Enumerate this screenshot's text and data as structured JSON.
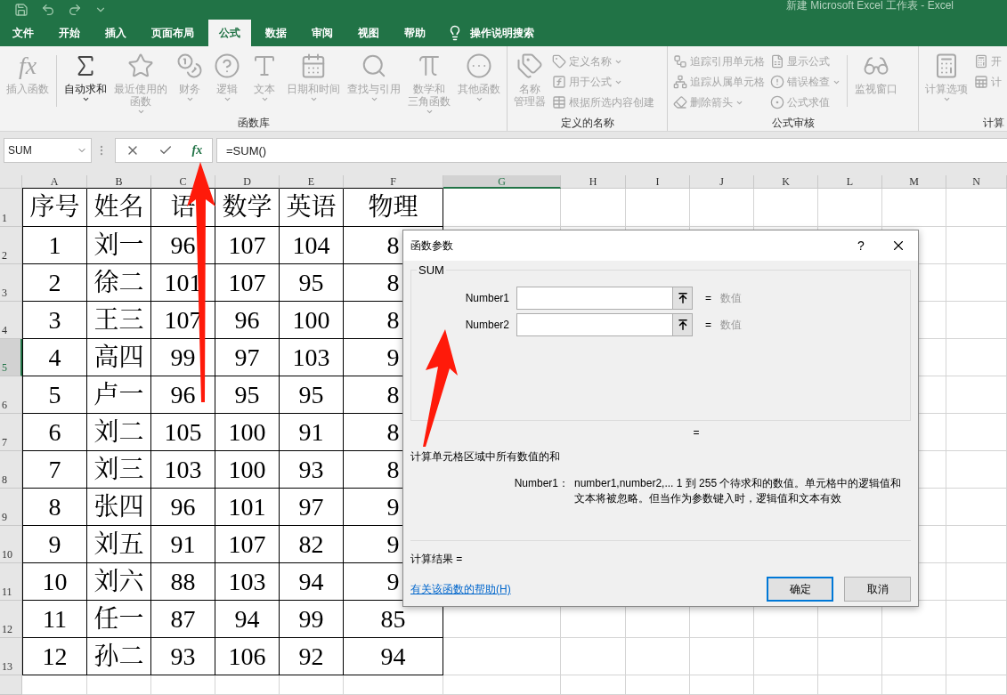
{
  "title_bar": {
    "title": "新建 Microsoft Excel 工作表  -  Excel"
  },
  "ribbon_tabs": [
    {
      "label": "文件",
      "selected": false
    },
    {
      "label": "开始",
      "selected": false
    },
    {
      "label": "插入",
      "selected": false
    },
    {
      "label": "页面布局",
      "selected": false
    },
    {
      "label": "公式",
      "selected": true
    },
    {
      "label": "数据",
      "selected": false
    },
    {
      "label": "审阅",
      "selected": false
    },
    {
      "label": "视图",
      "selected": false
    },
    {
      "label": "帮助",
      "selected": false
    }
  ],
  "tell_me": "操作说明搜索",
  "ribbon_groups": [
    {
      "label": "函数库",
      "items": [
        {
          "kind": "large",
          "lines": [
            "插入函数"
          ],
          "glyph": "fx",
          "disabled": true,
          "dropdown": false
        },
        {
          "kind": "separator"
        },
        {
          "kind": "large",
          "lines": [
            "自动求和"
          ],
          "disabled": false,
          "dropdown": true
        },
        {
          "kind": "large",
          "lines": [
            "最近使用的",
            "函数"
          ],
          "disabled": true,
          "dropdown": true
        },
        {
          "kind": "large",
          "lines": [
            "财务"
          ],
          "disabled": true,
          "dropdown": true
        },
        {
          "kind": "large",
          "lines": [
            "逻辑"
          ],
          "disabled": true,
          "dropdown": true
        },
        {
          "kind": "large",
          "lines": [
            "文本"
          ],
          "disabled": true,
          "dropdown": true
        },
        {
          "kind": "large",
          "lines": [
            "日期和时间"
          ],
          "disabled": true,
          "dropdown": true
        },
        {
          "kind": "large",
          "lines": [
            "查找与引用"
          ],
          "disabled": true,
          "dropdown": true
        },
        {
          "kind": "large",
          "lines": [
            "数学和",
            "三角函数"
          ],
          "disabled": true,
          "dropdown": true
        },
        {
          "kind": "large",
          "lines": [
            "其他函数"
          ],
          "disabled": true,
          "dropdown": true
        }
      ]
    },
    {
      "label": "定义的名称",
      "items": [
        {
          "kind": "large",
          "lines": [
            "名称",
            "管理器"
          ],
          "disabled": true,
          "dropdown": false
        },
        {
          "kind": "stack",
          "items": [
            {
              "label": "定义名称",
              "disabled": true,
              "dropdown": true
            },
            {
              "label": "用于公式",
              "disabled": true,
              "dropdown": true
            },
            {
              "label": "根据所选内容创建",
              "disabled": true,
              "dropdown": false
            }
          ]
        }
      ]
    },
    {
      "label": "公式审核",
      "items": [
        {
          "kind": "stack",
          "items": [
            {
              "label": "追踪引用单元格",
              "disabled": true,
              "dropdown": false
            },
            {
              "label": "追踪从属单元格",
              "disabled": true,
              "dropdown": false
            },
            {
              "label": "删除箭头",
              "disabled": true,
              "dropdown": true
            }
          ]
        },
        {
          "kind": "stack",
          "items": [
            {
              "label": "显示公式",
              "disabled": true,
              "dropdown": false
            },
            {
              "label": "错误检查",
              "disabled": true,
              "dropdown": true
            },
            {
              "label": "公式求值",
              "disabled": true,
              "dropdown": false
            }
          ]
        },
        {
          "kind": "separator"
        },
        {
          "kind": "large",
          "lines": [
            "监视窗口"
          ],
          "disabled": true,
          "dropdown": false
        }
      ]
    },
    {
      "label": "计算",
      "items": [
        {
          "kind": "large",
          "lines": [
            "计算选项"
          ],
          "disabled": true,
          "dropdown": true
        },
        {
          "kind": "stack",
          "items": [
            {
              "label": "开",
              "disabled": true,
              "dropdown": false
            },
            {
              "label": "计",
              "disabled": true,
              "dropdown": false
            }
          ]
        }
      ]
    }
  ],
  "formula_bar": {
    "name_box": "SUM",
    "insert_function": "fx",
    "formula": "=SUM()"
  },
  "columns": [
    {
      "label": "A",
      "selected": false
    },
    {
      "label": "B",
      "selected": false
    },
    {
      "label": "C",
      "selected": false
    },
    {
      "label": "D",
      "selected": false
    },
    {
      "label": "E",
      "selected": false
    },
    {
      "label": "F",
      "selected": false
    },
    {
      "label": "G",
      "selected": true
    },
    {
      "label": "H",
      "selected": false
    },
    {
      "label": "I",
      "selected": false
    },
    {
      "label": "J",
      "selected": false
    },
    {
      "label": "K",
      "selected": false
    },
    {
      "label": "L",
      "selected": false
    },
    {
      "label": "M",
      "selected": false
    },
    {
      "label": "N",
      "selected": false
    }
  ],
  "rows": [
    {
      "label": "1",
      "selected": false,
      "cells": [
        "序号",
        "姓名",
        "语",
        "数学",
        "英语",
        "物理"
      ]
    },
    {
      "label": "2",
      "selected": false,
      "cells": [
        "1",
        "刘一",
        "96",
        "107",
        "104",
        "8"
      ]
    },
    {
      "label": "3",
      "selected": false,
      "cells": [
        "2",
        "徐二",
        "101",
        "107",
        "95",
        "8"
      ]
    },
    {
      "label": "4",
      "selected": false,
      "cells": [
        "3",
        "王三",
        "107",
        "96",
        "100",
        "8"
      ]
    },
    {
      "label": "5",
      "selected": true,
      "cells": [
        "4",
        "高四",
        "99",
        "97",
        "103",
        "9"
      ]
    },
    {
      "label": "6",
      "selected": false,
      "cells": [
        "5",
        "卢一",
        "96",
        "95",
        "95",
        "8"
      ]
    },
    {
      "label": "7",
      "selected": false,
      "cells": [
        "6",
        "刘二",
        "105",
        "100",
        "91",
        "8"
      ]
    },
    {
      "label": "8",
      "selected": false,
      "cells": [
        "7",
        "刘三",
        "103",
        "100",
        "93",
        "8"
      ]
    },
    {
      "label": "9",
      "selected": false,
      "cells": [
        "8",
        "张四",
        "96",
        "101",
        "97",
        "9"
      ]
    },
    {
      "label": "10",
      "selected": false,
      "cells": [
        "9",
        "刘五",
        "91",
        "107",
        "82",
        "9"
      ]
    },
    {
      "label": "11",
      "selected": false,
      "cells": [
        "10",
        "刘六",
        "88",
        "103",
        "94",
        "9"
      ]
    },
    {
      "label": "12",
      "selected": false,
      "cells": [
        "11",
        "任一",
        "87",
        "94",
        "99",
        "85"
      ]
    },
    {
      "label": "13",
      "selected": false,
      "cells": [
        "12",
        "孙二",
        "93",
        "106",
        "92",
        "94"
      ]
    }
  ],
  "dialog": {
    "title": "函数参数",
    "help": "?",
    "function_name": "SUM",
    "args": [
      {
        "label": "Number1",
        "equals": "=",
        "hint": "数值"
      },
      {
        "label": "Number2",
        "equals": "=",
        "hint": "数值"
      }
    ],
    "result_equals": "=",
    "description": "计算单元格区域中所有数值的和",
    "arg_help_label": "Number1：",
    "arg_help_text": "number1,number2,...  1 到 255 个待求和的数值。单元格中的逻辑值和文本将被忽略。但当作为参数键入时，逻辑值和文本有效",
    "result_label": "计算结果 =",
    "help_link": "有关该函数的帮助(H)",
    "buttons": [
      {
        "label": "确定",
        "default": true
      },
      {
        "label": "取消",
        "default": false
      }
    ]
  }
}
